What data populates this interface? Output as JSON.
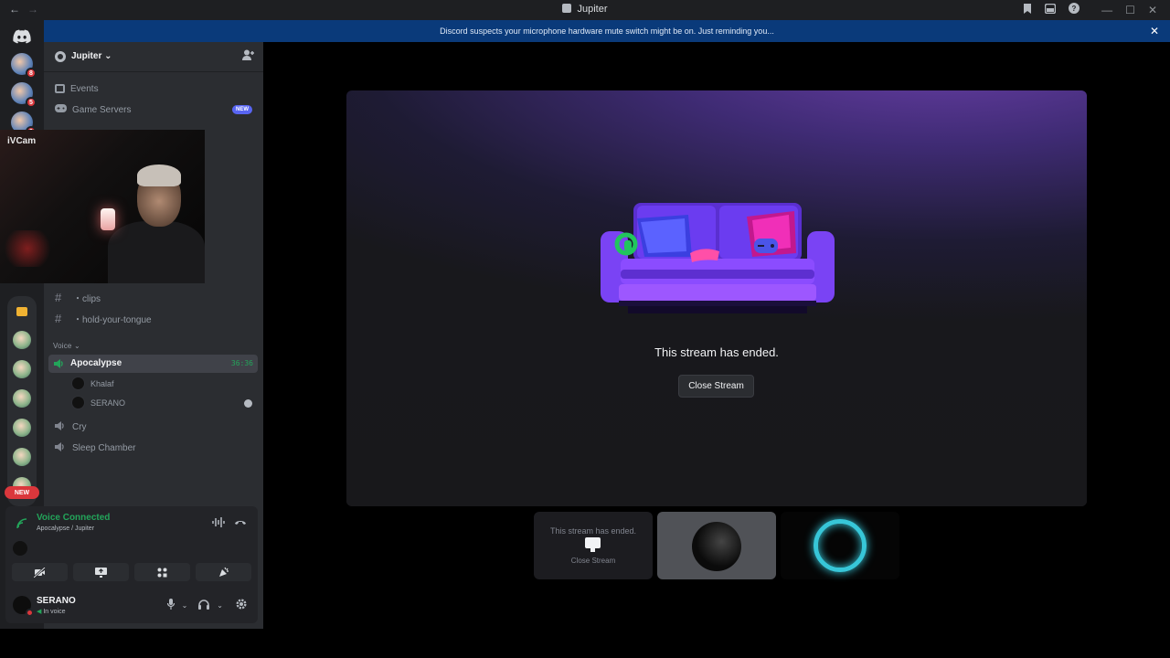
{
  "window": {
    "title": "Jupiter",
    "back": "←",
    "forward": "→",
    "minimize": "—",
    "maximize": "☐",
    "close": "✕"
  },
  "notice": {
    "text": "Discord suspects your microphone hardware mute switch might be on. Just reminding you...",
    "close": "✕"
  },
  "rail": {
    "badges": [
      "8",
      "5",
      "9"
    ],
    "new_pill": "NEW"
  },
  "server": {
    "name": "Jupiter",
    "chevron": "⌄",
    "menu": [
      {
        "label": "Events"
      },
      {
        "label": "Game Servers",
        "badge": "NEW"
      }
    ]
  },
  "webcam": {
    "label": "iVCam"
  },
  "channels": {
    "text": [
      {
        "label": "・clips"
      },
      {
        "label": "・hold-your-tongue"
      }
    ],
    "voice_category": "Voice",
    "voice_category_chevron": "⌄",
    "active_voice": {
      "label": "Apocalypse",
      "timer": "36:36"
    },
    "voice_users": [
      "Khalaf",
      "SERANO"
    ],
    "other_voice": [
      "Cry",
      "Sleep Chamber"
    ]
  },
  "voice_panel": {
    "status": "Voice Connected",
    "location": "Apocalypse / Jupiter",
    "username": "SERANO",
    "user_status": "In voice"
  },
  "stage": {
    "message": "This stream has ended.",
    "close_button": "Close Stream"
  },
  "tiles": {
    "ended_text": "This stream has ended.",
    "close_text": "Close Stream"
  }
}
